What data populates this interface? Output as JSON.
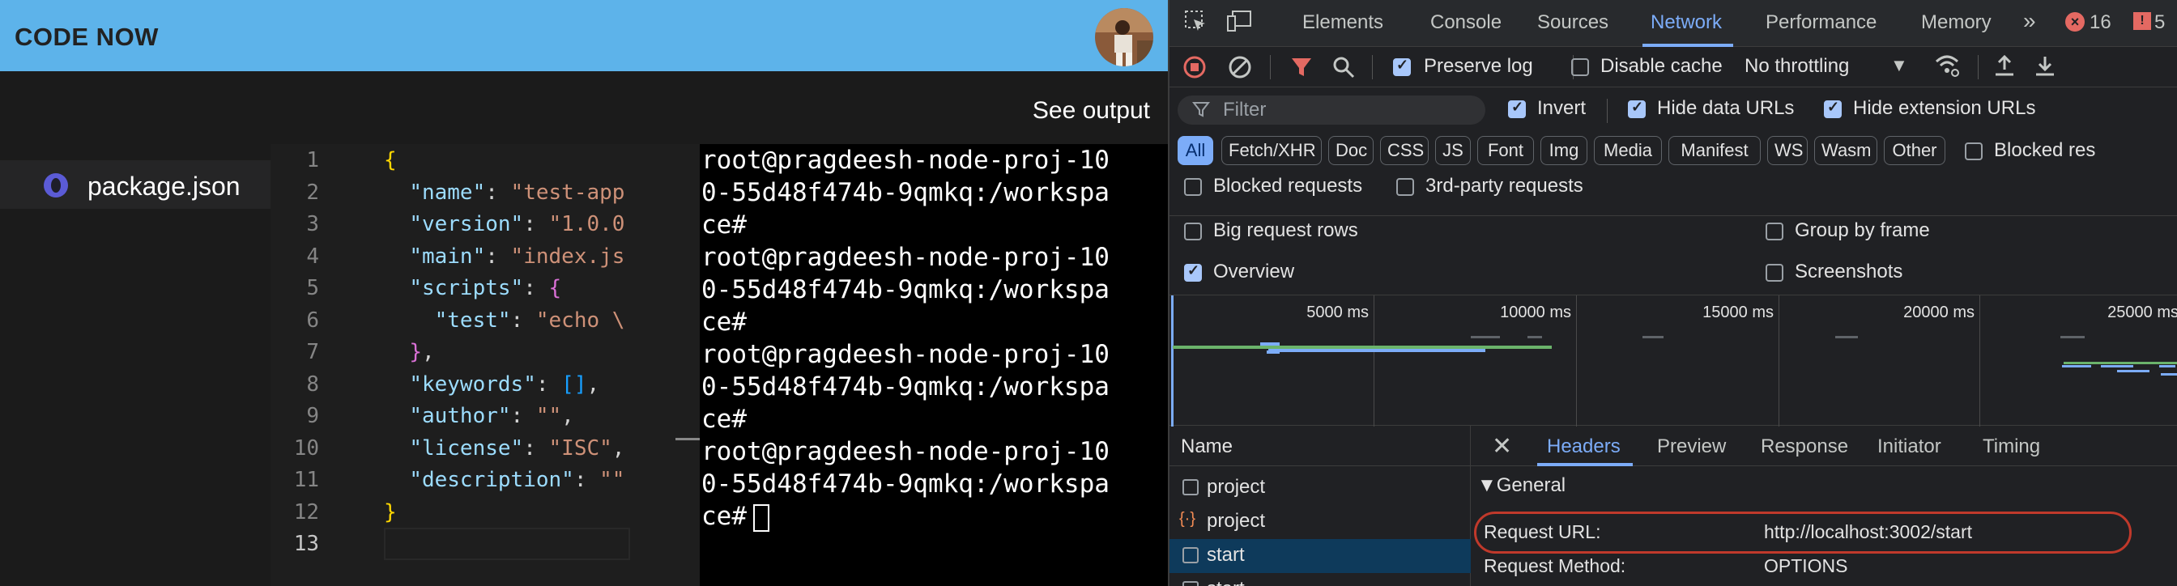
{
  "app": {
    "title": "CODE NOW",
    "see_output": "See output",
    "file_name": "package.json"
  },
  "editor": {
    "line_numbers": [
      "1",
      "2",
      "3",
      "4",
      "5",
      "6",
      "7",
      "8",
      "9",
      "10",
      "11",
      "12",
      "13"
    ],
    "lines": [
      [
        {
          "t": "{",
          "c": "b1"
        }
      ],
      [
        {
          "t": "  ",
          "c": "p"
        },
        {
          "t": "\"name\"",
          "c": "k"
        },
        {
          "t": ": ",
          "c": "p"
        },
        {
          "t": "\"test-app",
          "c": "s"
        }
      ],
      [
        {
          "t": "  ",
          "c": "p"
        },
        {
          "t": "\"version\"",
          "c": "k"
        },
        {
          "t": ": ",
          "c": "p"
        },
        {
          "t": "\"1.0.0",
          "c": "s"
        }
      ],
      [
        {
          "t": "  ",
          "c": "p"
        },
        {
          "t": "\"main\"",
          "c": "k"
        },
        {
          "t": ": ",
          "c": "p"
        },
        {
          "t": "\"index.js",
          "c": "s"
        }
      ],
      [
        {
          "t": "  ",
          "c": "p"
        },
        {
          "t": "\"scripts\"",
          "c": "k"
        },
        {
          "t": ": ",
          "c": "p"
        },
        {
          "t": "{",
          "c": "b2"
        }
      ],
      [
        {
          "t": "    ",
          "c": "p"
        },
        {
          "t": "\"test\"",
          "c": "k"
        },
        {
          "t": ": ",
          "c": "p"
        },
        {
          "t": "\"echo \\",
          "c": "s"
        }
      ],
      [
        {
          "t": "  ",
          "c": "p"
        },
        {
          "t": "}",
          "c": "b2"
        },
        {
          "t": ",",
          "c": "p"
        }
      ],
      [
        {
          "t": "  ",
          "c": "p"
        },
        {
          "t": "\"keywords\"",
          "c": "k"
        },
        {
          "t": ": ",
          "c": "p"
        },
        {
          "t": "[]",
          "c": "b3"
        },
        {
          "t": ",",
          "c": "p"
        }
      ],
      [
        {
          "t": "  ",
          "c": "p"
        },
        {
          "t": "\"author\"",
          "c": "k"
        },
        {
          "t": ": ",
          "c": "p"
        },
        {
          "t": "\"\"",
          "c": "s"
        },
        {
          "t": ",",
          "c": "p"
        }
      ],
      [
        {
          "t": "  ",
          "c": "p"
        },
        {
          "t": "\"license\"",
          "c": "k"
        },
        {
          "t": ": ",
          "c": "p"
        },
        {
          "t": "\"ISC\"",
          "c": "s"
        },
        {
          "t": ",",
          "c": "p"
        }
      ],
      [
        {
          "t": "  ",
          "c": "p"
        },
        {
          "t": "\"description\"",
          "c": "k"
        },
        {
          "t": ": ",
          "c": "p"
        },
        {
          "t": "\"\"",
          "c": "s"
        }
      ],
      [
        {
          "t": "}",
          "c": "b1"
        }
      ],
      []
    ]
  },
  "terminal": {
    "lines": [
      "root@pragdeesh-node-proj-10",
      "0-55d48f474b-9qmkq:/workspa",
      "ce#",
      "root@pragdeesh-node-proj-10",
      "0-55d48f474b-9qmkq:/workspa",
      "ce#",
      "root@pragdeesh-node-proj-10",
      "0-55d48f474b-9qmkq:/workspa",
      "ce#",
      "root@pragdeesh-node-proj-10",
      "0-55d48f474b-9qmkq:/workspa",
      "ce#"
    ]
  },
  "devtools": {
    "tabs": [
      "Elements",
      "Console",
      "Sources",
      "Network",
      "Performance",
      "Memory"
    ],
    "active_tab": "Network",
    "more": "»",
    "error_count": "16",
    "warning_count": "5",
    "toolbar": {
      "preserve_log": "Preserve log",
      "disable_cache": "Disable cache",
      "throttling": "No throttling"
    },
    "filter": {
      "placeholder": "Filter",
      "invert": "Invert",
      "hide_data_urls": "Hide data URLs",
      "hide_extension_urls": "Hide extension URLs"
    },
    "chips": [
      "All",
      "Fetch/XHR",
      "Doc",
      "CSS",
      "JS",
      "Font",
      "Img",
      "Media",
      "Manifest",
      "WS",
      "Wasm",
      "Other"
    ],
    "blocked_res": "Blocked res",
    "blocked_requests": "Blocked requests",
    "third_party": "3rd-party requests",
    "big_rows": "Big request rows",
    "group_by_frame": "Group by frame",
    "overview": "Overview",
    "screenshots": "Screenshots",
    "timeline_labels": [
      "5000 ms",
      "10000 ms",
      "15000 ms",
      "20000 ms",
      "25000 ms"
    ],
    "name_header": "Name",
    "requests": [
      "project",
      "project",
      "start",
      "start"
    ],
    "detail_tabs": [
      "Headers",
      "Preview",
      "Response",
      "Initiator",
      "Timing"
    ],
    "section": "▼General",
    "request_url_key": "Request URL:",
    "request_url_val": "http://localhost:3002/start",
    "request_method_key": "Request Method:",
    "request_method_val": "OPTIONS"
  }
}
